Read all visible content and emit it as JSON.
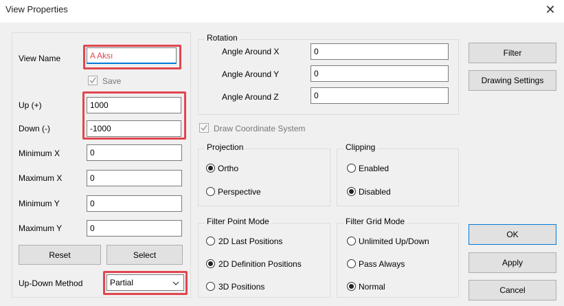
{
  "window": {
    "title": "View Properties"
  },
  "fields": {
    "view_name_label": "View Name",
    "view_name_value": "A Aksı",
    "save_label": "Save",
    "up_label": "Up (+)",
    "up_value": "1000",
    "down_label": "Down (-)",
    "down_value": "-1000",
    "min_x_label": "Minimum X",
    "min_x_value": "0",
    "max_x_label": "Maximum X",
    "max_x_value": "0",
    "min_y_label": "Minimum Y",
    "min_y_value": "0",
    "max_y_label": "Maximum Y",
    "max_y_value": "0",
    "reset_label": "Reset",
    "select_label": "Select",
    "updown_method_label": "Up-Down Method",
    "updown_method_value": "Partial"
  },
  "rotation": {
    "group_label": "Rotation",
    "x_label": "Angle Around X",
    "x_value": "0",
    "y_label": "Angle Around Y",
    "y_value": "0",
    "z_label": "Angle Around Z",
    "z_value": "0"
  },
  "draw_coordinate_system_label": "Draw Coordinate System",
  "projection": {
    "group_label": "Projection",
    "ortho_label": "Ortho",
    "perspective_label": "Perspective",
    "selected": "Ortho"
  },
  "clipping": {
    "group_label": "Clipping",
    "enabled_label": "Enabled",
    "disabled_label": "Disabled",
    "selected": "Disabled"
  },
  "filter_point_mode": {
    "group_label": "Filter Point Mode",
    "opt1": "2D Last Positions",
    "opt2": "2D Definition Positions",
    "opt3": "3D Positions",
    "selected": "2D Definition Positions"
  },
  "filter_grid_mode": {
    "group_label": "Filter Grid Mode",
    "opt1": "Unlimited Up/Down",
    "opt2": "Pass Always",
    "opt3": "Normal",
    "selected": "Normal"
  },
  "buttons": {
    "filter": "Filter",
    "drawing_settings": "Drawing Settings",
    "ok": "OK",
    "apply": "Apply",
    "cancel": "Cancel"
  },
  "colors": {
    "highlight": "#e0464e",
    "view_name_text": "#e0464e",
    "primary_border": "#0078d7"
  }
}
